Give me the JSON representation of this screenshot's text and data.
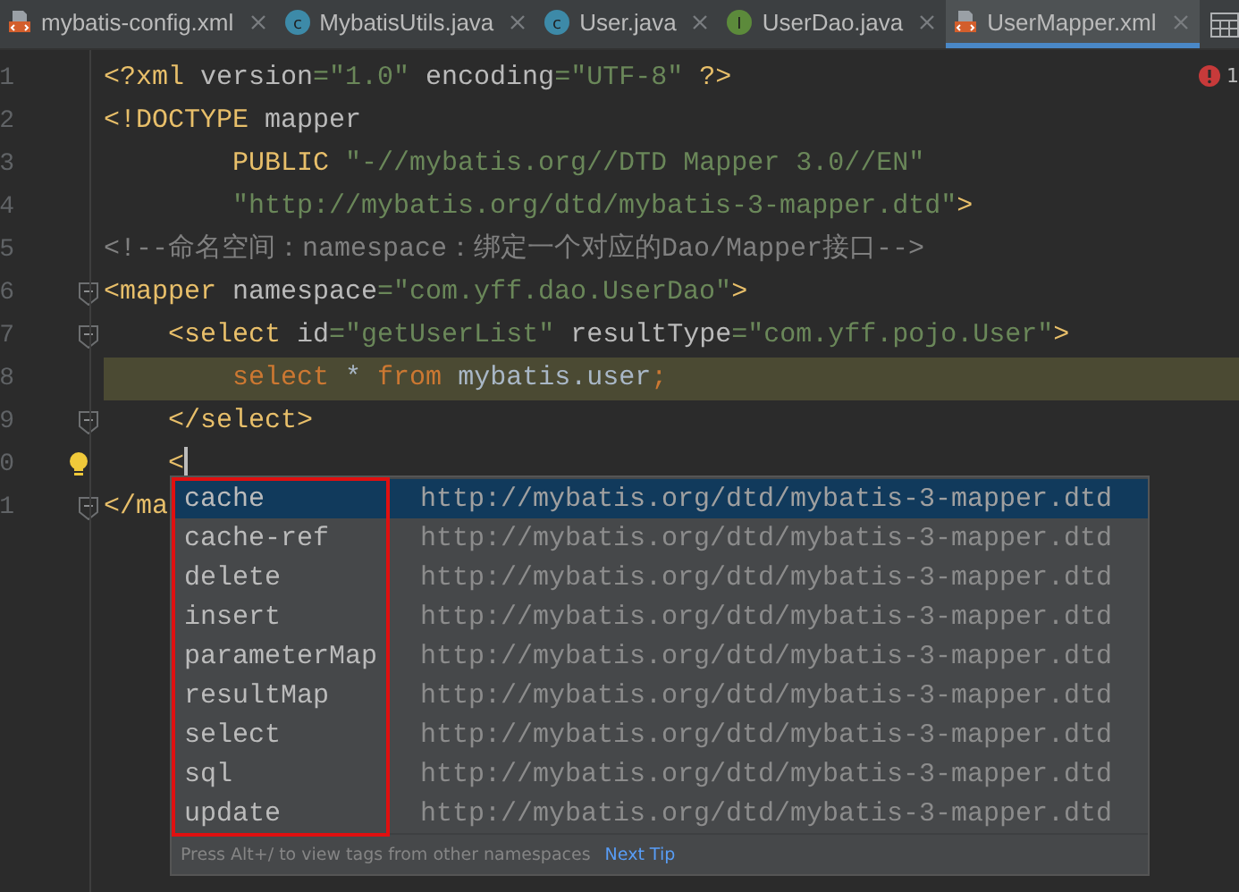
{
  "tabs": [
    {
      "kind": "xml",
      "label": "mybatis-config.xml",
      "selected": false
    },
    {
      "kind": "class",
      "badge": "c",
      "label": "MybatisUtils.java",
      "selected": false
    },
    {
      "kind": "class",
      "badge": "c",
      "label": "User.java",
      "selected": false
    },
    {
      "kind": "interface",
      "badge": "I",
      "label": "UserDao.java",
      "selected": false
    },
    {
      "kind": "xml",
      "label": "UserMapper.xml",
      "selected": true
    }
  ],
  "error_count": "1",
  "lines": [
    {
      "number": "1",
      "fold": false,
      "bulb": false,
      "caret": false,
      "highlighted": false,
      "tokens": [
        {
          "kind": "tag",
          "text": "<?xml"
        },
        {
          "kind": "attr",
          "text": " version"
        },
        {
          "kind": "str",
          "text": "=\"1.0\""
        },
        {
          "kind": "attr",
          "text": " encoding"
        },
        {
          "kind": "str",
          "text": "=\"UTF-8\""
        },
        {
          "kind": "tag",
          "text": " ?>"
        }
      ]
    },
    {
      "number": "2",
      "fold": false,
      "bulb": false,
      "caret": false,
      "highlighted": false,
      "tokens": [
        {
          "kind": "tag",
          "text": "<!DOCTYPE"
        },
        {
          "kind": "attr",
          "text": " mapper"
        }
      ]
    },
    {
      "number": "3",
      "fold": false,
      "bulb": false,
      "caret": false,
      "highlighted": false,
      "tokens": [
        {
          "kind": "tag",
          "text": "        PUBLIC"
        },
        {
          "kind": "str",
          "text": " \"-//mybatis.org//DTD Mapper 3.0//EN\""
        }
      ]
    },
    {
      "number": "4",
      "fold": false,
      "bulb": false,
      "caret": false,
      "highlighted": false,
      "tokens": [
        {
          "kind": "str",
          "text": "        \"http://mybatis.org/dtd/mybatis-3-mapper.dtd\""
        },
        {
          "kind": "tag",
          "text": ">"
        }
      ]
    },
    {
      "number": "5",
      "fold": false,
      "bulb": false,
      "caret": false,
      "highlighted": false,
      "tokens": [
        {
          "kind": "comment",
          "text": "<!--命名空间：namespace：绑定一个对应的Dao/Mapper接口-->"
        }
      ]
    },
    {
      "number": "6",
      "fold": true,
      "bulb": false,
      "caret": false,
      "highlighted": false,
      "tokens": [
        {
          "kind": "tag",
          "text": "<mapper"
        },
        {
          "kind": "attr",
          "text": " namespace"
        },
        {
          "kind": "str",
          "text": "=\"com.yff.dao.UserDao\""
        },
        {
          "kind": "tag",
          "text": ">"
        }
      ]
    },
    {
      "number": "7",
      "fold": true,
      "bulb": false,
      "caret": false,
      "highlighted": false,
      "tokens": [
        {
          "kind": "tag",
          "text": "    <select"
        },
        {
          "kind": "attr",
          "text": " id"
        },
        {
          "kind": "str",
          "text": "=\"getUserList\""
        },
        {
          "kind": "attr",
          "text": " resultType"
        },
        {
          "kind": "str",
          "text": "=\"com.yff.pojo.User\""
        },
        {
          "kind": "tag",
          "text": ">"
        }
      ]
    },
    {
      "number": "8",
      "fold": false,
      "bulb": false,
      "caret": false,
      "highlighted": true,
      "tokens": [
        {
          "kind": "kw",
          "text": "        select"
        },
        {
          "kind": "plain",
          "text": " * "
        },
        {
          "kind": "kw",
          "text": "from"
        },
        {
          "kind": "plain",
          "text": " mybatis.user"
        },
        {
          "kind": "kw",
          "text": ";"
        }
      ]
    },
    {
      "number": "9",
      "fold": true,
      "bulb": false,
      "caret": false,
      "highlighted": false,
      "tokens": [
        {
          "kind": "tag",
          "text": "    </select>"
        }
      ]
    },
    {
      "number": "0",
      "fold": false,
      "bulb": true,
      "caret": true,
      "highlighted": false,
      "tokens": [
        {
          "kind": "tag",
          "text": "    <"
        }
      ]
    },
    {
      "number": "1",
      "fold": true,
      "bulb": false,
      "caret": false,
      "highlighted": false,
      "tokens": [
        {
          "kind": "tag",
          "text": "</ma"
        }
      ]
    }
  ],
  "completion": {
    "names_outlined": true,
    "items": [
      {
        "name": "cache",
        "source": "http://mybatis.org/dtd/mybatis-3-mapper.dtd",
        "selected": true
      },
      {
        "name": "cache-ref",
        "source": "http://mybatis.org/dtd/mybatis-3-mapper.dtd",
        "selected": false
      },
      {
        "name": "delete",
        "source": "http://mybatis.org/dtd/mybatis-3-mapper.dtd",
        "selected": false
      },
      {
        "name": "insert",
        "source": "http://mybatis.org/dtd/mybatis-3-mapper.dtd",
        "selected": false
      },
      {
        "name": "parameterMap",
        "source": "http://mybatis.org/dtd/mybatis-3-mapper.dtd",
        "selected": false
      },
      {
        "name": "resultMap",
        "source": "http://mybatis.org/dtd/mybatis-3-mapper.dtd",
        "selected": false
      },
      {
        "name": "select",
        "source": "http://mybatis.org/dtd/mybatis-3-mapper.dtd",
        "selected": false
      },
      {
        "name": "sql",
        "source": "http://mybatis.org/dtd/mybatis-3-mapper.dtd",
        "selected": false
      },
      {
        "name": "update",
        "source": "http://mybatis.org/dtd/mybatis-3-mapper.dtd",
        "selected": false
      }
    ],
    "hint": "Press Alt+/ to view tags from other namespaces",
    "hint_link": "Next Tip"
  }
}
